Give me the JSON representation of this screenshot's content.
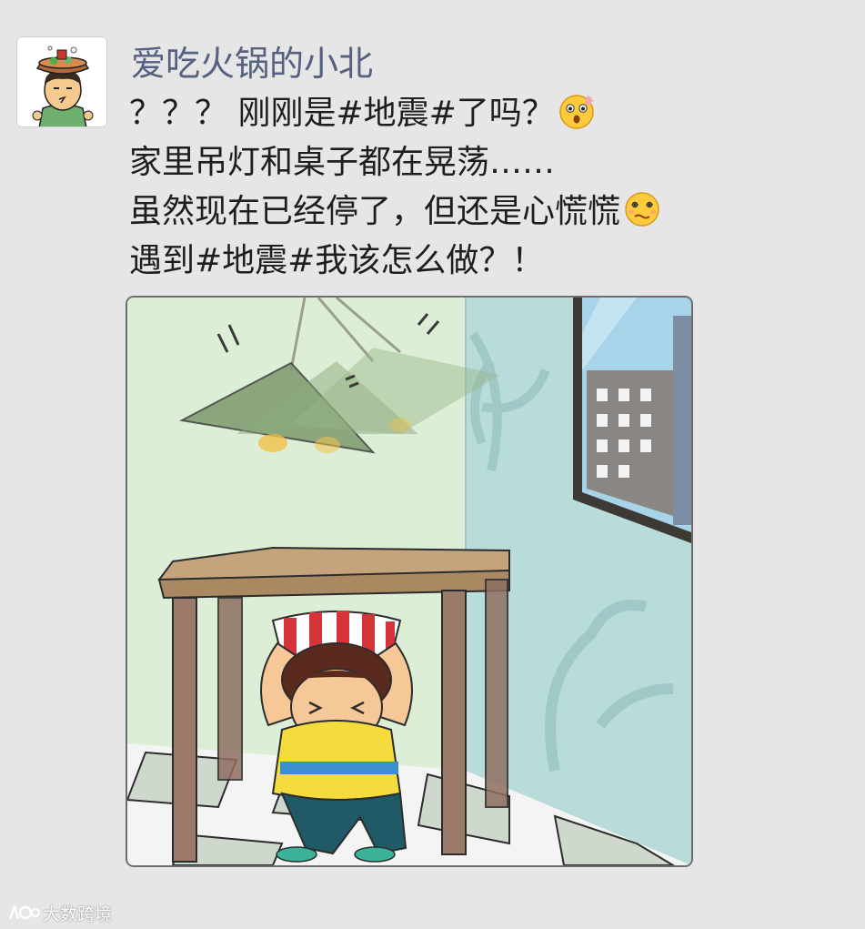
{
  "post": {
    "username": "爱吃火锅的小北",
    "lines": [
      "？？？ 刚刚是#地震#了吗？",
      "家里吊灯和桌子都在晃荡……",
      "虽然现在已经停了，但还是心慌慌",
      "遇到#地震#我该怎么做？！"
    ],
    "emojis": [
      "shocked-emoji",
      "dizzy-emoji"
    ],
    "image": {
      "subject": "earthquake-table-illustration"
    }
  },
  "watermark": {
    "text": "大数跨境"
  },
  "colors": {
    "username": "#55617e",
    "text": "#1e1e1e",
    "background": "#e6e6e6"
  }
}
